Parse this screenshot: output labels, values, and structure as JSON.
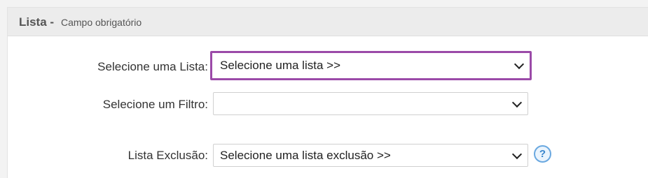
{
  "header": {
    "title": "Lista -",
    "subtitle": "Campo obrigatório"
  },
  "fields": {
    "lista": {
      "label": "Selecione uma Lista:",
      "selected": "Selecione uma lista >>"
    },
    "filtro": {
      "label": "Selecione um Filtro:",
      "selected": ""
    },
    "exclusao": {
      "label": "Lista Exclusão:",
      "selected": "Selecione uma lista exclusão >>"
    }
  },
  "help": {
    "glyph": "?",
    "icon": "question-circle-icon"
  },
  "colors": {
    "focus_border": "#9b4aa8",
    "help_icon": "#3a86cc"
  }
}
